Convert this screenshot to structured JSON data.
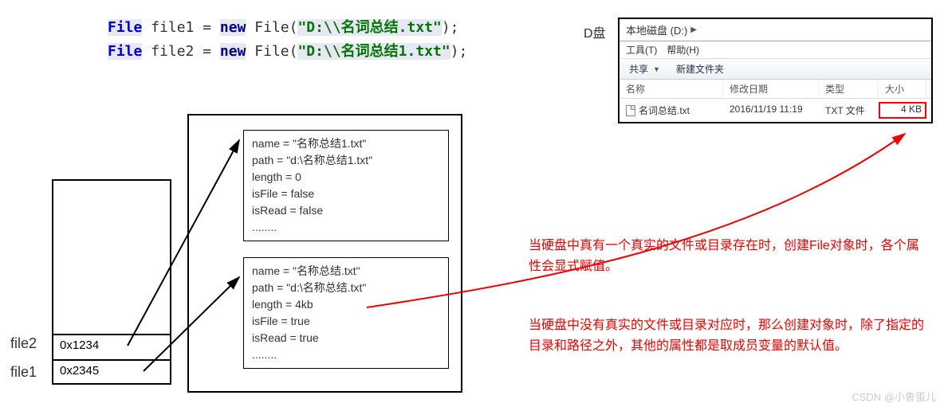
{
  "code": {
    "line1_type": "File",
    "line1_var": "file1",
    "line1_eq": " = ",
    "line1_new": "new",
    "line1_ctor": "File",
    "line1_str": "\"D:\\\\名词总结.txt\"",
    "line2_type": "File",
    "line2_var": "file2",
    "line2_eq": " = ",
    "line2_new": "new",
    "line2_ctor": "File",
    "line2_str": "\"D:\\\\名词总结1.txt\""
  },
  "stack": {
    "file2_label": "file2",
    "file1_label": "file1",
    "addr_file2": "0x1234",
    "addr_file1": "0x2345"
  },
  "obj1": {
    "l1": "name = \"名称总结1.txt\"",
    "l2": "path = \"d:\\名称总结1.txt\"",
    "l3": "length = 0",
    "l4": "isFile = false",
    "l5": "isRead = false",
    "l6": "........"
  },
  "obj2": {
    "l1": "name = \"名称总结.txt\"",
    "l2": "path = \"d:\\名称总结.txt\"",
    "l3": "length = 4kb",
    "l4": "isFile = true",
    "l5": "isRead = true",
    "l6": "........"
  },
  "d_label": "D盘",
  "explorer": {
    "addr": "本地磁盘 (D:)",
    "menu1": "工具(T)",
    "menu2": "帮助(H)",
    "tb1": "共享",
    "tb2": "新建文件夹",
    "col1": "名称",
    "col2": "修改日期",
    "col3": "类型",
    "col4": "大小",
    "row_name": "名词总结.txt",
    "row_date": "2016/11/19 11:19",
    "row_type": "TXT 文件",
    "row_size": "4 KB"
  },
  "red1": "当硬盘中真有一个真实的文件或目录存在时，创建File对象时，各个属性会显式赋值。",
  "red2": "当硬盘中没有真实的文件或目录对应时，那么创建对象时，除了指定的目录和路径之外，其他的属性都是取成员变量的默认值。",
  "watermark": "CSDN @小鲁蛋儿"
}
